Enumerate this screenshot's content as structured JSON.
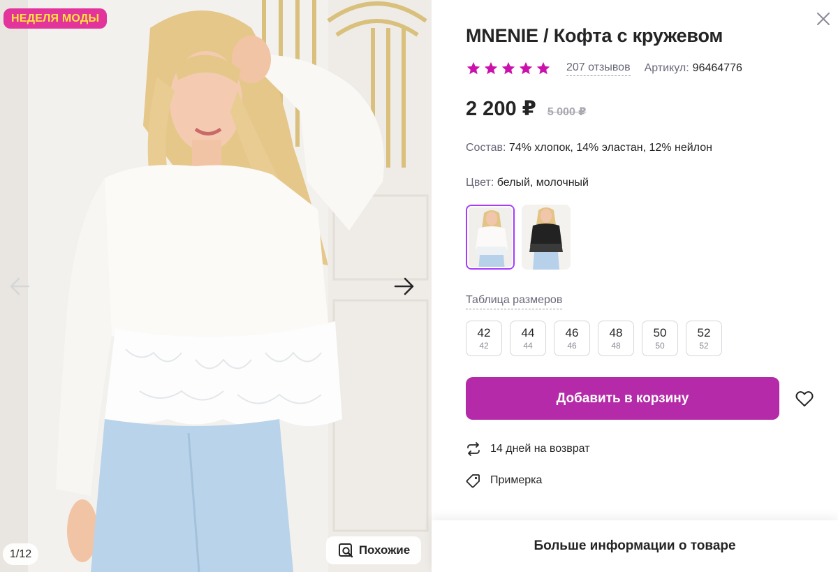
{
  "gallery": {
    "badge": "НЕДЕЛЯ МОДЫ",
    "counter": "1/12",
    "similar_label": "Похожие",
    "colors": {
      "badge_bg": "#e2349a",
      "badge_text": "#ffe43a"
    }
  },
  "product": {
    "title": "MNENIE / Кофта с кружевом",
    "rating": 5,
    "reviews": "207 отзывов",
    "article_label": "Артикул:",
    "article_value": "96464776",
    "price": "2 200 ₽",
    "old_price": "5 000 ₽",
    "composition_label": "Состав:",
    "composition_value": "74% хлопок, 14% эластан, 12% нейлон",
    "color_label": "Цвет:",
    "color_value": "белый, молочный",
    "variants": [
      {
        "color": "white"
      },
      {
        "color": "black"
      }
    ],
    "size_table_label": "Таблица размеров",
    "sizes": [
      {
        "main": "42",
        "sub": "42"
      },
      {
        "main": "44",
        "sub": "44"
      },
      {
        "main": "46",
        "sub": "46"
      },
      {
        "main": "48",
        "sub": "48"
      },
      {
        "main": "50",
        "sub": "50"
      },
      {
        "main": "52",
        "sub": "52"
      }
    ],
    "add_to_cart": "Добавить в корзину",
    "features": [
      {
        "icon": "return-arrows-icon",
        "text": "14 дней на возврат"
      },
      {
        "icon": "tag-icon",
        "text": "Примерка"
      }
    ],
    "more_info": "Больше информации о товаре",
    "colors": {
      "accent": "#b52aa8",
      "stars": "#cb11ab",
      "selected_border": "#a73afd"
    }
  }
}
